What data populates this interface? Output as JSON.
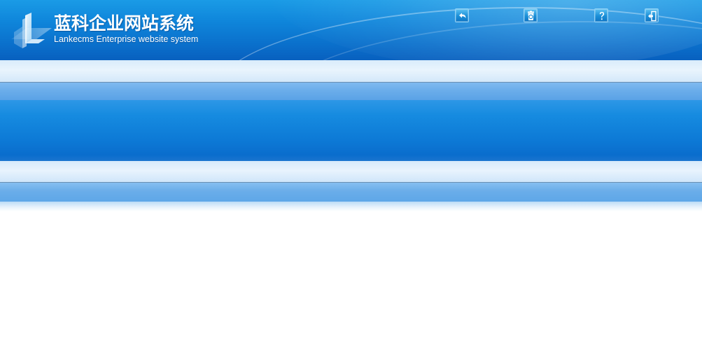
{
  "header": {
    "title_cn": "蓝科企业网站系统",
    "title_en": "Lankecms Enterprise website system",
    "logo_icon": "lankecms-logo-icon",
    "colors": {
      "header_top": "#1a9be6",
      "header_bottom": "#0860bf",
      "band_light": "#e9f4fd",
      "band_mid": "#69acea",
      "band_blue": "#0d7ad6"
    }
  },
  "toolbar": {
    "buttons": [
      {
        "icon": "back-icon"
      },
      {
        "icon": "refresh-icon"
      },
      {
        "icon": "help-icon"
      },
      {
        "icon": "logout-icon"
      }
    ]
  }
}
